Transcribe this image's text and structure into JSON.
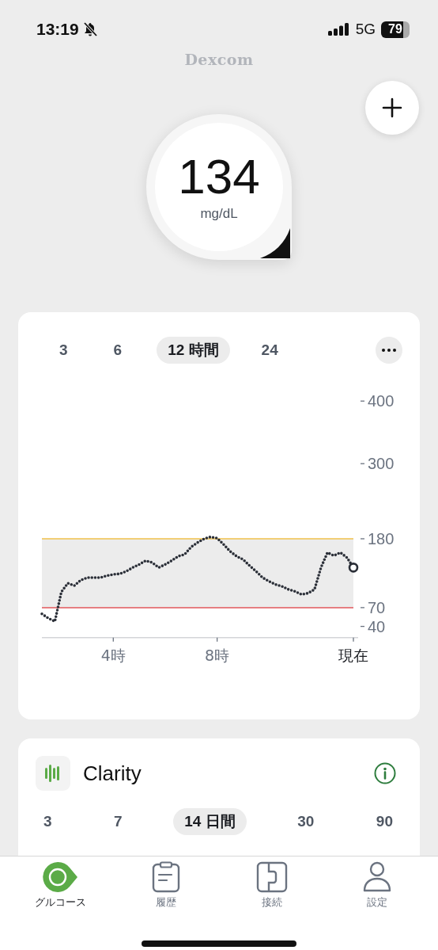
{
  "status_bar": {
    "time": "13:19",
    "network": "5G",
    "battery": "79"
  },
  "brand": "Dexcom",
  "reading": {
    "value": "134",
    "unit": "mg/dL"
  },
  "graph": {
    "ranges": [
      {
        "label": "3",
        "selected": false
      },
      {
        "label": "6",
        "selected": false
      },
      {
        "label": "12 時間",
        "selected": true
      },
      {
        "label": "24",
        "selected": false
      }
    ],
    "chart_data": {
      "type": "line",
      "ylim": [
        22,
        400
      ],
      "categories": [
        null,
        null,
        null,
        null,
        null,
        null,
        null,
        null,
        null,
        null,
        null,
        "4時",
        null,
        null,
        null,
        null,
        null,
        null,
        null,
        null,
        null,
        null,
        null,
        null,
        null,
        null,
        null,
        "8時",
        null,
        null,
        null,
        null,
        null,
        null,
        null,
        null,
        null,
        null,
        null,
        null,
        null,
        null,
        null,
        null,
        null,
        null,
        null,
        null,
        "現在"
      ],
      "series": [
        {
          "color": "#2b2f38",
          "line_style": "dotted",
          "values": [
            60,
            53,
            48,
            95,
            109,
            105,
            114,
            118,
            118,
            118,
            121,
            123,
            124,
            128,
            134,
            139,
            145,
            142,
            134,
            139,
            145,
            152,
            155,
            167,
            174,
            180,
            183,
            181,
            171,
            160,
            152,
            147,
            137,
            128,
            118,
            112,
            107,
            104,
            99,
            96,
            91,
            93,
            99,
            134,
            158,
            153,
            158,
            150,
            134
          ]
        }
      ],
      "yticks": [
        40,
        70,
        180,
        300,
        400
      ],
      "bands": [
        {
          "axis": "y",
          "from": 70,
          "to": 180,
          "color": "#ececec"
        }
      ],
      "ref_lines": [
        {
          "axis": "y",
          "value": 180,
          "color": "#f0c24b"
        },
        {
          "axis": "y",
          "value": 70,
          "color": "#e0575b"
        }
      ]
    }
  },
  "clarity": {
    "title": "Clarity",
    "ranges": [
      {
        "label": "3",
        "selected": false
      },
      {
        "label": "7",
        "selected": false
      },
      {
        "label": "14 日間",
        "selected": true
      },
      {
        "label": "30",
        "selected": false
      },
      {
        "label": "90",
        "selected": false
      }
    ]
  },
  "tab_bar": [
    {
      "kind": "glucose",
      "label": "グルコース",
      "selected": true
    },
    {
      "kind": "history",
      "label": "履歴",
      "selected": false
    },
    {
      "kind": "connect",
      "label": "接続",
      "selected": false
    },
    {
      "kind": "settings",
      "label": "設定",
      "selected": false
    }
  ]
}
